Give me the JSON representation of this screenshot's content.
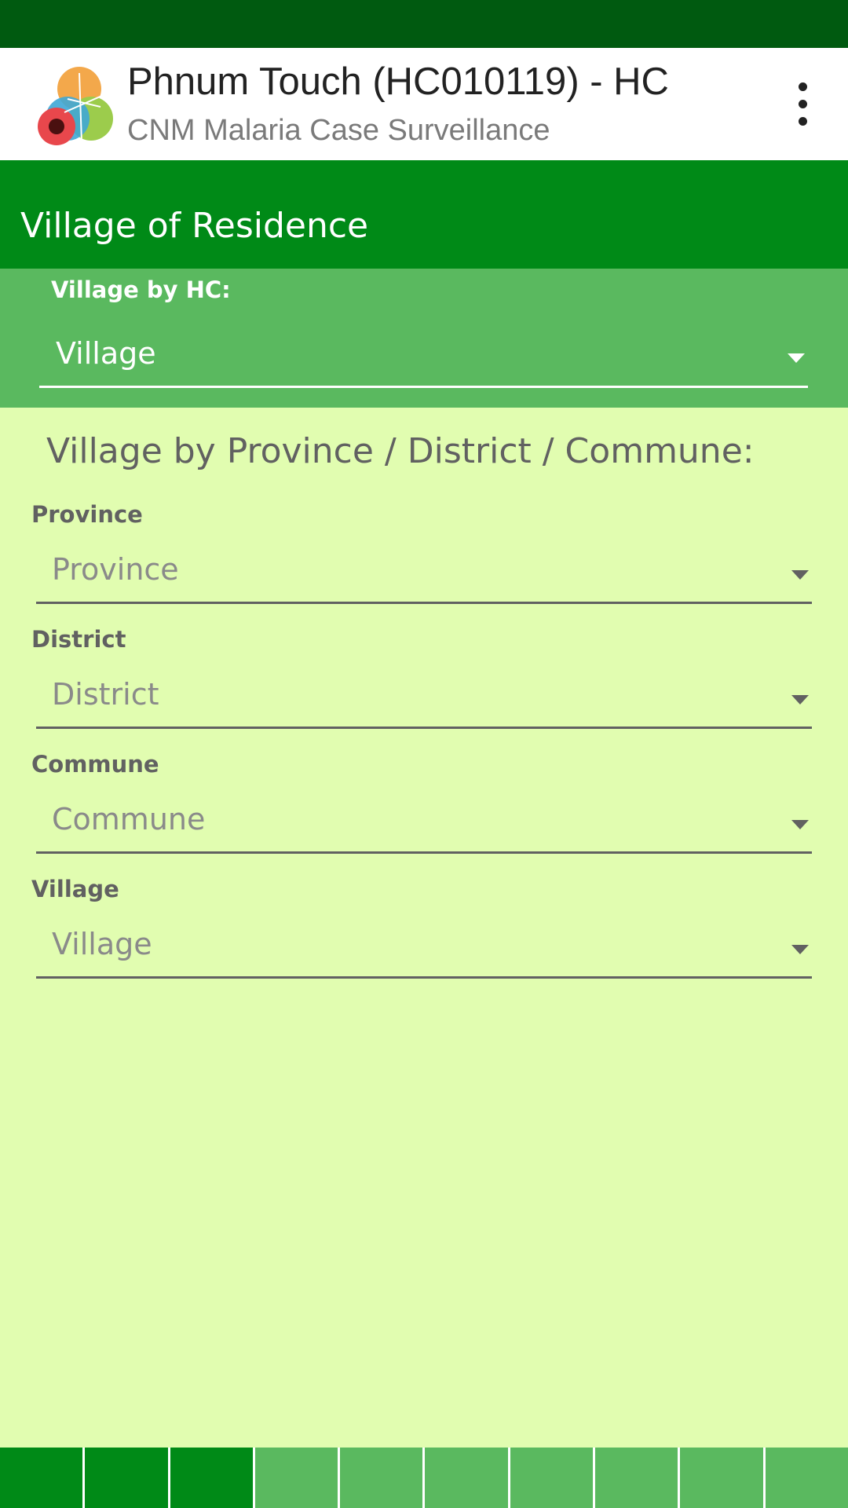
{
  "app_bar": {
    "logo_icon": "malaria-mosquito-logo-icon",
    "title": "Phnum Touch (HC010119) - HC",
    "subtitle": "CNM Malaria Case Surveillance",
    "menu_icon": "more-vert-icon"
  },
  "section": {
    "title": "Village of Residence"
  },
  "hc_selector": {
    "label": "Village by HC:",
    "value": "Village"
  },
  "location_form": {
    "heading": "Village by Province / District / Commune:",
    "fields": [
      {
        "label": "Province",
        "placeholder": "Province"
      },
      {
        "label": "District",
        "placeholder": "District"
      },
      {
        "label": "Commune",
        "placeholder": "Commune"
      },
      {
        "label": "Village",
        "placeholder": "Village"
      }
    ]
  },
  "page_progress": {
    "total_pages": 10,
    "completed_pages": 3
  },
  "colors": {
    "status_bar": "#005a10",
    "section_header": "#008a17",
    "hc_panel": "#5ab95f",
    "form_background": "#e1fdb0",
    "progress_done": "#008a17",
    "progress_todo": "#5ab95f"
  }
}
